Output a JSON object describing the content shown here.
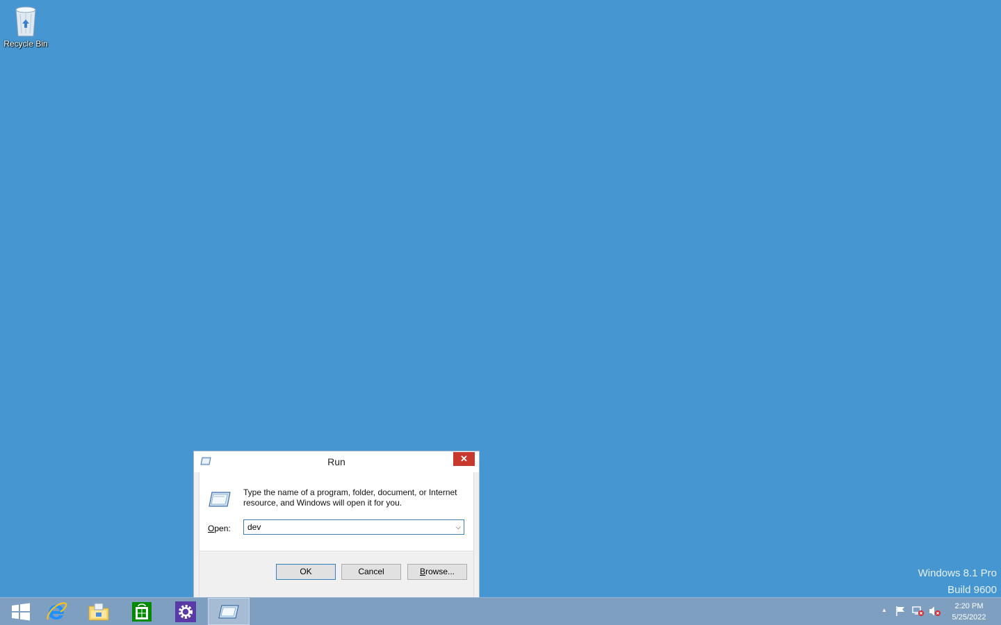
{
  "desktop": {
    "icons": [
      {
        "label": "Recycle Bin",
        "icon": "recycle-bin-icon"
      }
    ],
    "watermark": {
      "line1": "Windows 8.1 Pro",
      "line2": "Build 9600"
    },
    "background_color": "#4596d1"
  },
  "run_dialog": {
    "title": "Run",
    "close_symbol": "✕",
    "description": "Type the name of a program, folder, document, or Internet resource, and Windows will open it for you.",
    "open_label_accel": "O",
    "open_label_rest": "pen:",
    "open_value": "dev",
    "buttons": {
      "ok": "OK",
      "cancel": "Cancel",
      "browse_accel": "B",
      "browse_rest": "rowse..."
    }
  },
  "taskbar": {
    "items": [
      "start-icon",
      "internet-explorer-icon",
      "file-explorer-icon",
      "store-icon",
      "settings-icon",
      "run-icon"
    ],
    "active_item": "run-icon",
    "tray": {
      "overflow_symbol": "▲",
      "time": "2:20 PM",
      "date": "5/25/2022"
    }
  }
}
